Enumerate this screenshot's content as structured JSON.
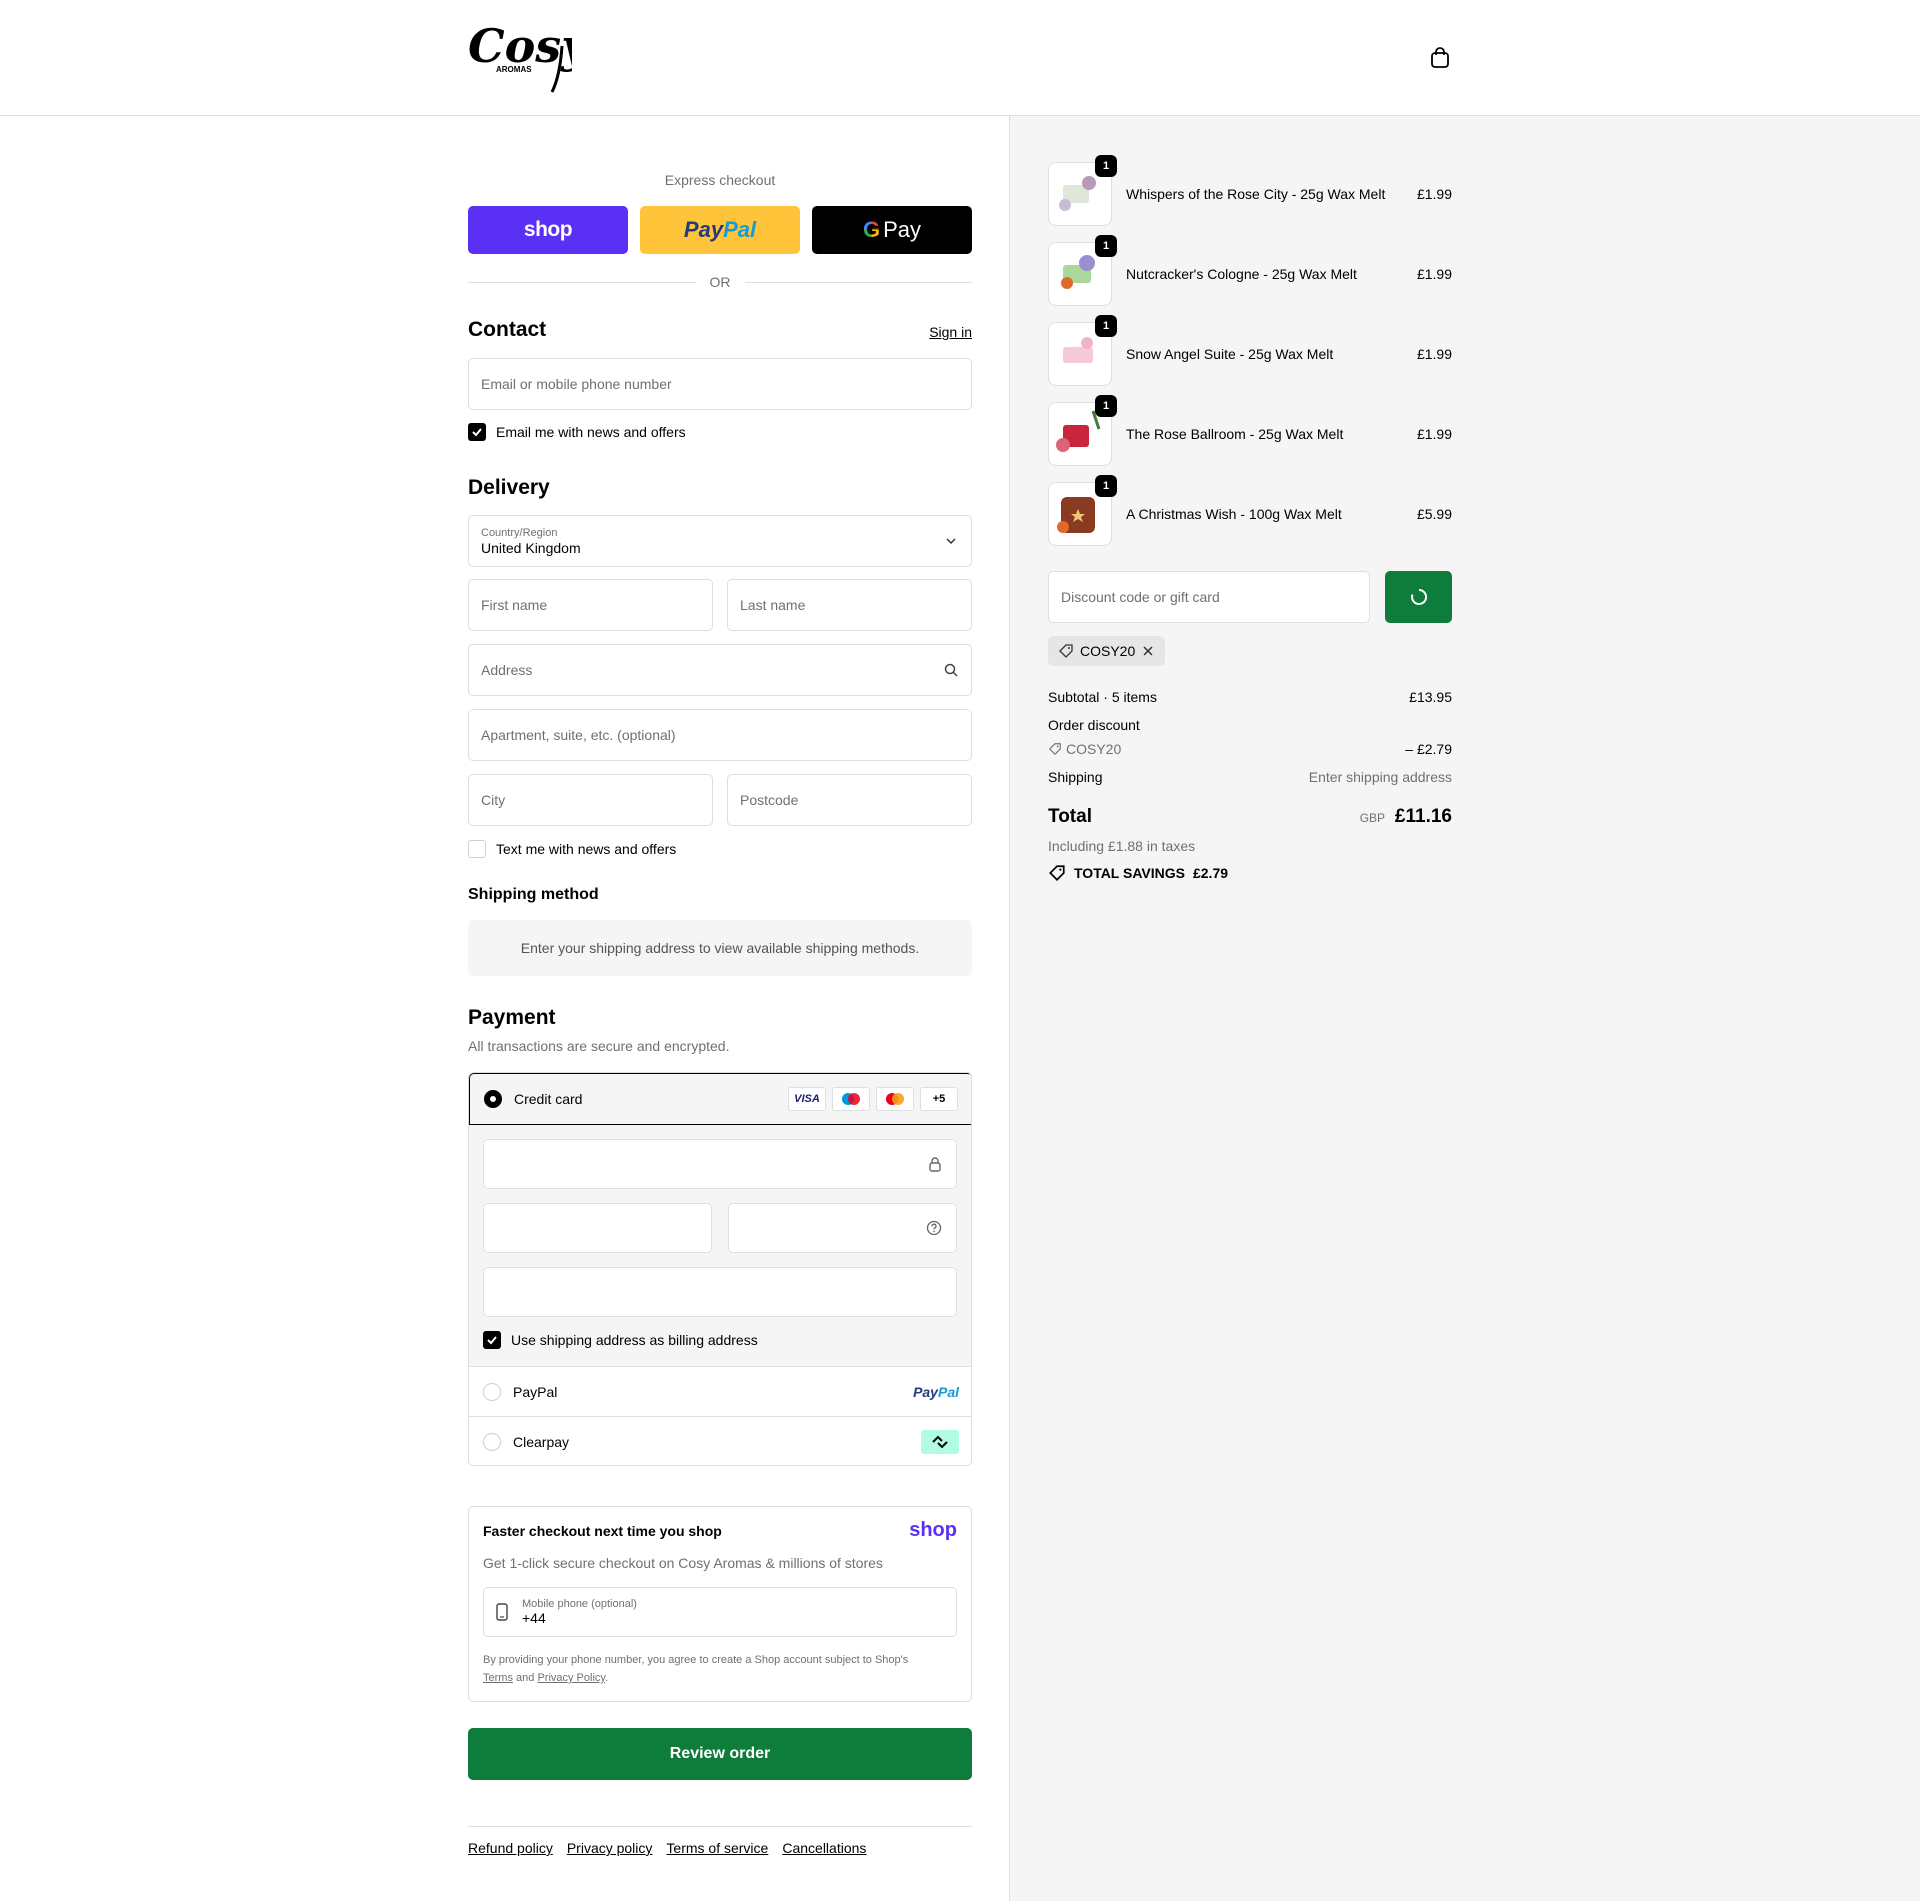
{
  "header": {
    "logo_text": "Cosy",
    "logo_sub": "AROMAS"
  },
  "express": {
    "title": "Express checkout",
    "shop_label": "shop",
    "paypal_label_1": "Pay",
    "paypal_label_2": "Pal",
    "gpay_label_g": "G",
    "gpay_label": "Pay",
    "or_label": "OR"
  },
  "contact": {
    "title": "Contact",
    "signin_label": "Sign in",
    "email_placeholder": "Email or mobile phone number",
    "email_offers_label": "Email me with news and offers",
    "email_offers_checked": true
  },
  "delivery": {
    "title": "Delivery",
    "country_label": "Country/Region",
    "country_value": "United Kingdom",
    "first_name_placeholder": "First name",
    "last_name_placeholder": "Last name",
    "address_placeholder": "Address",
    "apartment_placeholder": "Apartment, suite, etc. (optional)",
    "city_placeholder": "City",
    "postcode_placeholder": "Postcode",
    "text_offers_label": "Text me with news and offers",
    "text_offers_checked": false
  },
  "shipping_method": {
    "title": "Shipping method",
    "message": "Enter your shipping address to view available shipping methods."
  },
  "payment": {
    "title": "Payment",
    "subtitle": "All transactions are secure and encrypted.",
    "credit_card_label": "Credit card",
    "card_logos": [
      "VISA",
      "maestro",
      "mastercard",
      "+5"
    ],
    "billing_same_label": "Use shipping address as billing address",
    "billing_same_checked": true,
    "paypal_label": "PayPal",
    "paypal_logo_1": "Pay",
    "paypal_logo_2": "Pal",
    "clearpay_label": "Clearpay"
  },
  "shop_pay": {
    "title": "Faster checkout next time you shop",
    "logo": "shop",
    "subtitle": "Get 1-click secure checkout on Cosy Aromas & millions of stores",
    "phone_label": "Mobile phone (optional)",
    "phone_value": "+44",
    "legal_prefix": "By providing your phone number, you agree to create a Shop account subject to Shop's",
    "terms_label": "Terms",
    "and_label": "and",
    "privacy_label": "Privacy Policy",
    "legal_suffix": "."
  },
  "review_button": "Review order",
  "footer_links": [
    "Refund policy",
    "Privacy policy",
    "Terms of service",
    "Cancellations"
  ],
  "order": {
    "items": [
      {
        "name": "Whispers of the Rose City - 25g Wax Melt",
        "price": "£1.99",
        "qty": "1"
      },
      {
        "name": "Nutcracker's Cologne - 25g Wax Melt",
        "price": "£1.99",
        "qty": "1"
      },
      {
        "name": "Snow Angel Suite - 25g Wax Melt",
        "price": "£1.99",
        "qty": "1"
      },
      {
        "name": "The Rose Ballroom - 25g Wax Melt",
        "price": "£1.99",
        "qty": "1"
      },
      {
        "name": "A Christmas Wish - 100g Wax Melt",
        "price": "£5.99",
        "qty": "1"
      }
    ],
    "discount_placeholder": "Discount code or gift card",
    "applied_code": "COSY20",
    "subtotal_label": "Subtotal · 5 items",
    "subtotal_value": "£13.95",
    "order_discount_label": "Order discount",
    "discount_code": "COSY20",
    "discount_value": "– £2.79",
    "shipping_label": "Shipping",
    "shipping_value": "Enter shipping address",
    "total_label": "Total",
    "total_currency": "GBP",
    "total_value": "£11.16",
    "tax_note": "Including £1.88 in taxes",
    "savings_label": "TOTAL SAVINGS",
    "savings_value": "£2.79"
  },
  "colors": {
    "accent_green": "#0e7c3a",
    "shop_purple": "#5a31f4",
    "paypal_yellow": "#ffc439",
    "border": "#dedede",
    "panel_bg": "#f5f5f5"
  }
}
